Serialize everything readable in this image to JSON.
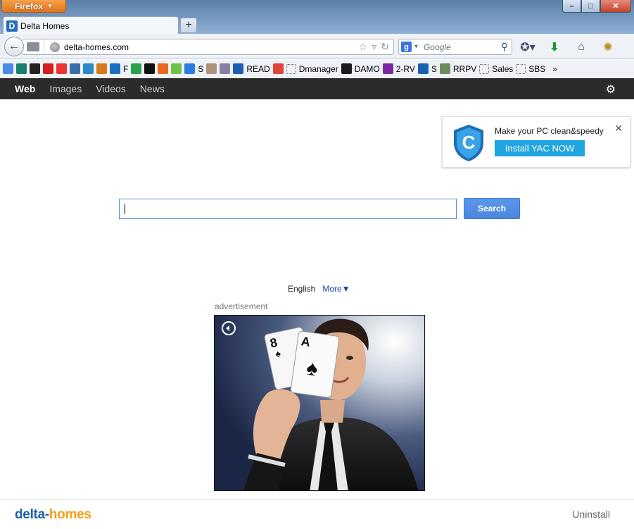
{
  "browser": {
    "app_button": "Firefox",
    "tab_title": "Delta Homes",
    "tab_favicon_letter": "D",
    "url": "delta-homes.com",
    "search_engine_letter": "g",
    "search_placeholder": "Google",
    "window_controls": {
      "minimize": "–",
      "maximize": "□",
      "close": "✕"
    }
  },
  "bookmarks": [
    {
      "label": "",
      "icon": "google-icon"
    },
    {
      "label": "",
      "icon": "e-icon"
    },
    {
      "label": "",
      "icon": "paw-icon"
    },
    {
      "label": "",
      "icon": "i-red-icon"
    },
    {
      "label": "",
      "icon": "lifebuoy-icon"
    },
    {
      "label": "",
      "icon": "python-icon"
    },
    {
      "label": "",
      "icon": "network-icon"
    },
    {
      "label": "",
      "icon": "cg-icon"
    },
    {
      "label": "F",
      "icon": "bird-icon"
    },
    {
      "label": "",
      "icon": "windows-icon"
    },
    {
      "label": "",
      "icon": "terminal-icon"
    },
    {
      "label": "",
      "icon": "firefox-icon"
    },
    {
      "label": "",
      "icon": "ball-icon"
    },
    {
      "label": "S",
      "icon": "m-icon"
    },
    {
      "label": "",
      "icon": "photo-icon"
    },
    {
      "label": "",
      "icon": "photo2-icon"
    },
    {
      "label": "READ",
      "icon": "gear-blue-icon"
    },
    {
      "label": "",
      "icon": "target-icon"
    },
    {
      "label": "Dmanager",
      "icon": "blank-icon"
    },
    {
      "label": "DAMO",
      "icon": "dm-icon"
    },
    {
      "label": "2-RV",
      "icon": "z-icon"
    },
    {
      "label": "S",
      "icon": "gear-blue-icon"
    },
    {
      "label": "RRPV",
      "icon": "money-icon"
    },
    {
      "label": "Sales",
      "icon": "blank-icon"
    },
    {
      "label": "SBS",
      "icon": "blank-icon"
    }
  ],
  "nav": {
    "items": [
      {
        "label": "Web",
        "active": true
      },
      {
        "label": "Images",
        "active": false
      },
      {
        "label": "Videos",
        "active": false
      },
      {
        "label": "News",
        "active": false
      }
    ]
  },
  "promo": {
    "text": "Make your PC clean&speedy",
    "button": "Install YAC NOW",
    "close": "✕",
    "shield_letter": "C"
  },
  "search": {
    "value": "",
    "button": "Search"
  },
  "language": {
    "current": "English",
    "more": "More▼"
  },
  "ad": {
    "label": "advertisement",
    "card_rank": "8",
    "card_rank2": "A"
  },
  "footer": {
    "logo_part1": "delta-",
    "logo_part2": "homes",
    "uninstall": "Uninstall"
  },
  "colors": {
    "nav_bg": "#2b2b2b",
    "search_button": "#4a86dc",
    "promo_button": "#1fa5e0",
    "logo_blue": "#1f5fa8",
    "logo_orange": "#f3a01a"
  }
}
